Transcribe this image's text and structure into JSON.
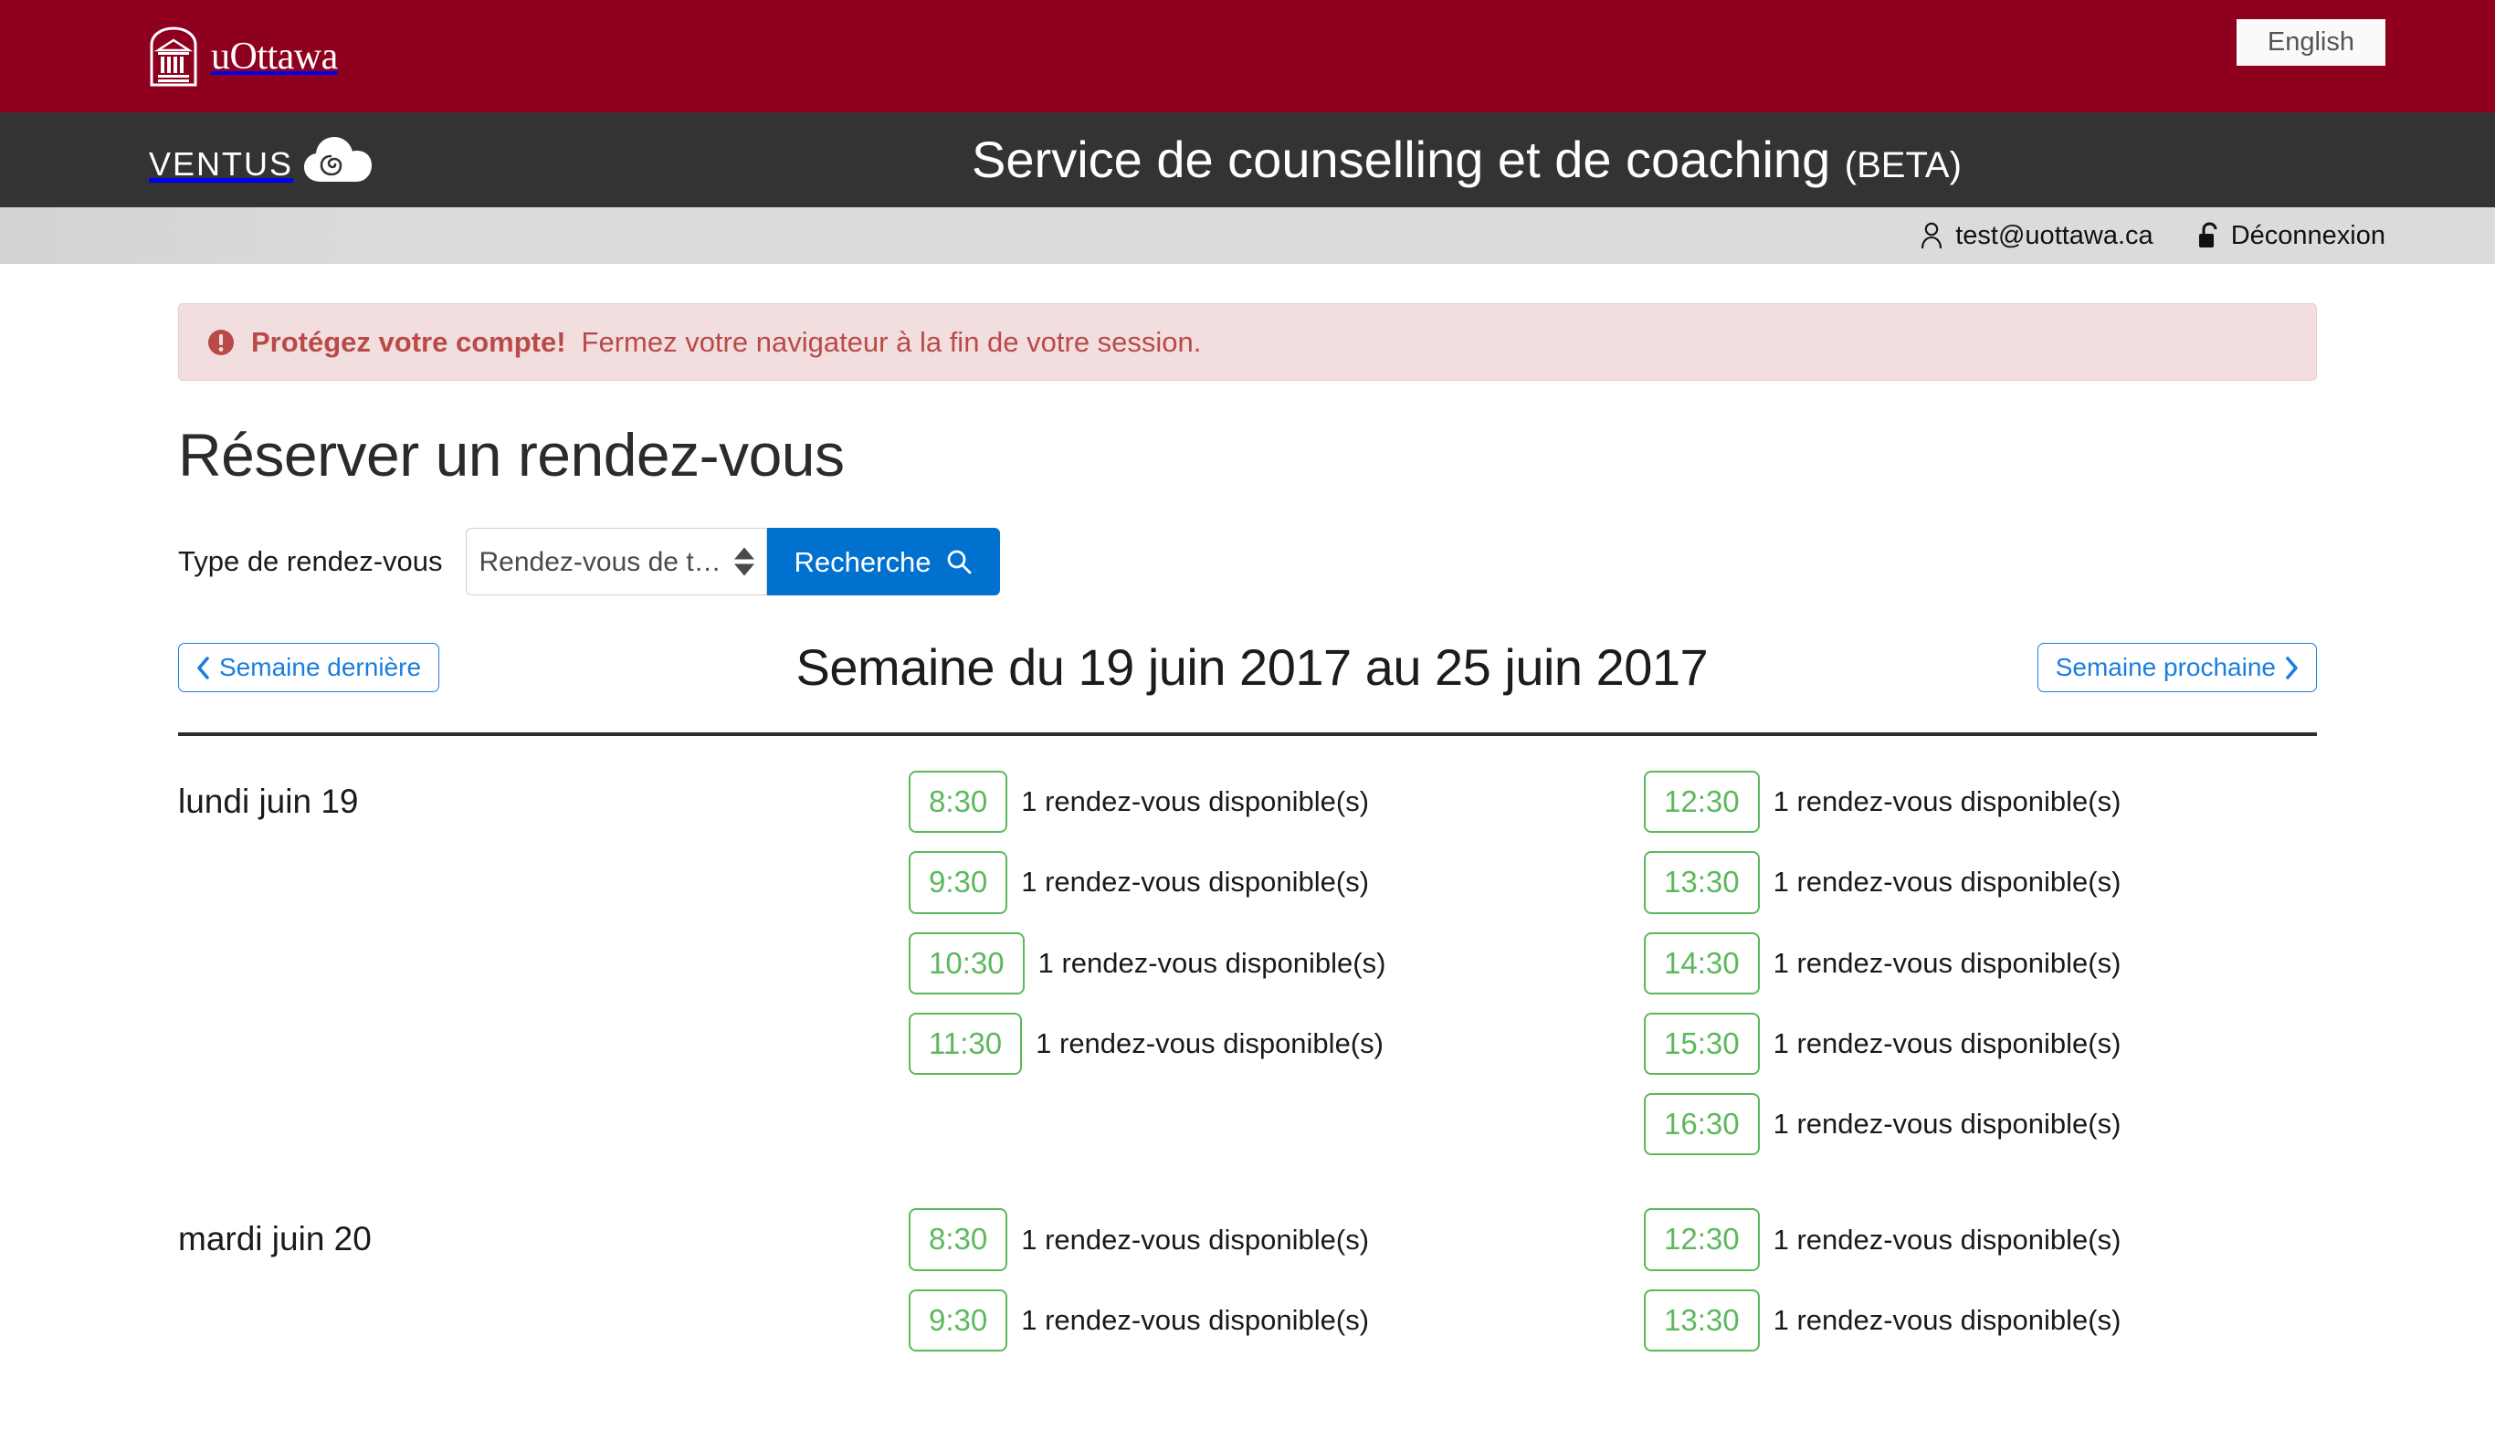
{
  "colors": {
    "uottawa_red": "#8F001F",
    "ventus_dark": "#333333",
    "accent_blue": "#0071ce",
    "link_blue": "#1a7ee0",
    "slot_green": "#5cb85c",
    "alert_bg": "#f2dede",
    "alert_text": "#b94a48"
  },
  "header": {
    "brand_name": "uOttawa",
    "crest_icon": "uottawa-crest-icon",
    "language_button": "English"
  },
  "appbar": {
    "product_name": "Ventus",
    "cloud_icon": "cloud-icon",
    "title": "Service de counselling et de coaching",
    "title_suffix": "(BETA)"
  },
  "userbar": {
    "user_icon": "user-icon",
    "email": "test@uottawa.ca",
    "lock_icon": "unlock-icon",
    "logout_label": "Déconnexion"
  },
  "alert": {
    "icon": "exclamation-circle-icon",
    "strong": "Protégez votre compte!",
    "message": "Fermez votre navigateur à la fin de votre session."
  },
  "page": {
    "title": "Réserver un rendez-vous"
  },
  "search": {
    "label": "Type de rendez-vous",
    "selected_option": "Rendez-vous de triage en anglais",
    "options": [
      "Rendez-vous de triage en anglais"
    ],
    "stepper_icon": "updown-arrows-icon",
    "button_label": "Recherche",
    "button_icon": "search-icon"
  },
  "week_nav": {
    "prev_label": "Semaine dernière",
    "prev_icon": "chevron-left-icon",
    "next_label": "Semaine prochaine",
    "next_icon": "chevron-right-icon",
    "title": "Semaine du 19 juin 2017 au 25 juin 2017"
  },
  "schedule": {
    "availability_text": "1 rendez-vous disponible(s)",
    "days": [
      {
        "name": "lundi juin 19",
        "columns": [
          {
            "slots": [
              {
                "time": "8:30",
                "availability": "1 rendez-vous disponible(s)"
              },
              {
                "time": "9:30",
                "availability": "1 rendez-vous disponible(s)"
              },
              {
                "time": "10:30",
                "availability": "1 rendez-vous disponible(s)"
              },
              {
                "time": "11:30",
                "availability": "1 rendez-vous disponible(s)"
              }
            ]
          },
          {
            "slots": [
              {
                "time": "12:30",
                "availability": "1 rendez-vous disponible(s)"
              },
              {
                "time": "13:30",
                "availability": "1 rendez-vous disponible(s)"
              },
              {
                "time": "14:30",
                "availability": "1 rendez-vous disponible(s)"
              },
              {
                "time": "15:30",
                "availability": "1 rendez-vous disponible(s)"
              },
              {
                "time": "16:30",
                "availability": "1 rendez-vous disponible(s)"
              }
            ]
          }
        ]
      },
      {
        "name": "mardi juin 20",
        "columns": [
          {
            "slots": [
              {
                "time": "8:30",
                "availability": "1 rendez-vous disponible(s)"
              },
              {
                "time": "9:30",
                "availability": "1 rendez-vous disponible(s)"
              }
            ]
          },
          {
            "slots": [
              {
                "time": "12:30",
                "availability": "1 rendez-vous disponible(s)"
              },
              {
                "time": "13:30",
                "availability": "1 rendez-vous disponible(s)"
              }
            ]
          }
        ]
      }
    ]
  }
}
